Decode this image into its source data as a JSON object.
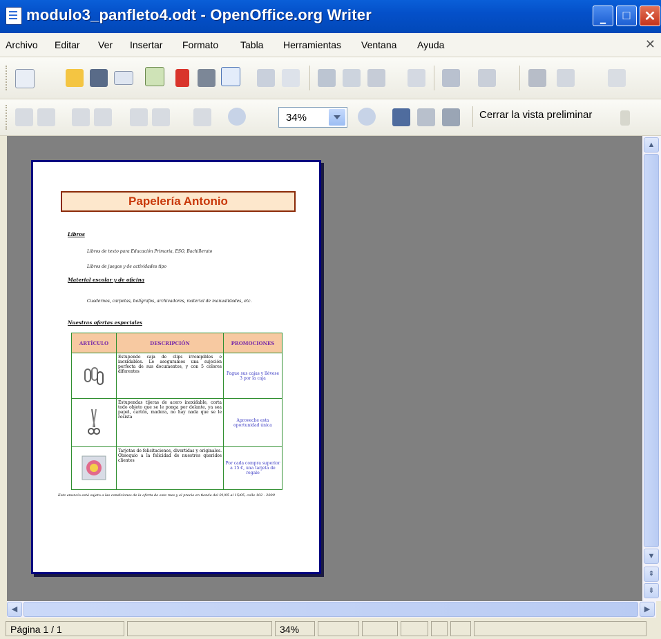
{
  "window": {
    "title": "modulo3_panfleto4.odt - OpenOffice.org Writer"
  },
  "menu": [
    "Archivo",
    "Editar",
    "Ver",
    "Insertar",
    "Formato",
    "Tabla",
    "Herramientas",
    "Ventana",
    "Ayuda"
  ],
  "preview_toolbar": {
    "zoom": "34%",
    "close_preview": "Cerrar la vista preliminar"
  },
  "document": {
    "title": "Papelería Antonio",
    "section1": "Libros",
    "bullet1": "Libros de texto para Educación Primaria, ESO, Bachillerato",
    "bullet2": "Libros de juegos y de actividades tipo",
    "section2": "Material escolar y de oficina",
    "bullet3": "Cuadernos, carpetas, bolígrafos, archivadores, material de manualidades, etc.",
    "section3": "Nuestras ofertas especiales",
    "table": {
      "headers": [
        "ARTÍCULO",
        "DESCRIPCIÓN",
        "PROMOCIONES"
      ],
      "rows": [
        {
          "desc": "Estupendo caja de clips irrompibles e inoxidables. Le aseguramos una sujeción perfecta de sus documentos, y con 5 colores diferentes",
          "promo": "Pague sus cajas y llévese 3 por la caja"
        },
        {
          "desc": "Estupendas tijeras de acero inoxidable, corta todo objeto que se le ponga por delante, ya sea papel, cartón, madera, no hay nada que se le resista",
          "promo": "Aproveche esta oportunidad única"
        },
        {
          "desc": "Tarjetas de felicitaciones, divertidas y originales. Obsequio a la felicidad de nuestros queridos clientes",
          "promo": "Por cada compra superior a 15 €, una tarjeta de regalo"
        }
      ]
    },
    "footer": "Este anuncio está sujeto a las condiciones de la oferta de este mes y el precio en tienda del 01/05 al 15/05, calle 102 - 2009"
  },
  "status": {
    "page": "Página 1 / 1",
    "zoom": "34%"
  }
}
